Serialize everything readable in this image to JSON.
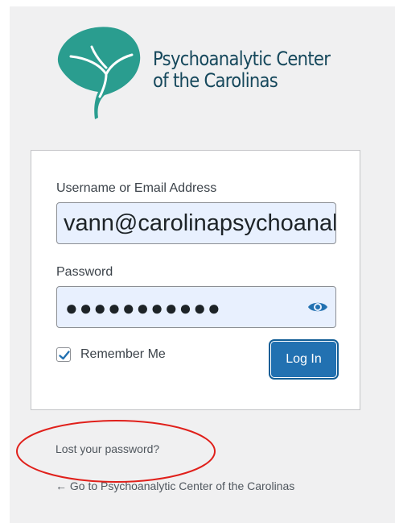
{
  "logo": {
    "line1": "Psychoanalytic Center",
    "line2": "of the Carolinas",
    "brand_color": "#2a9d8f",
    "text_color": "#16485c"
  },
  "form": {
    "username_label": "Username or Email Address",
    "username_value": "vann@carolinapsychoanalysis.org",
    "password_label": "Password",
    "password_dots": "●●●●●●●●●●●",
    "show_password_icon": "eye-icon",
    "remember_label": "Remember Me",
    "remember_checked": true,
    "login_button": "Log In",
    "button_color": "#2271b1"
  },
  "links": {
    "lost_password": "Lost your password?",
    "back_to_site": "← Go to Psychoanalytic Center of the Carolinas"
  },
  "annotation": {
    "ellipse_color": "#e0201b"
  }
}
